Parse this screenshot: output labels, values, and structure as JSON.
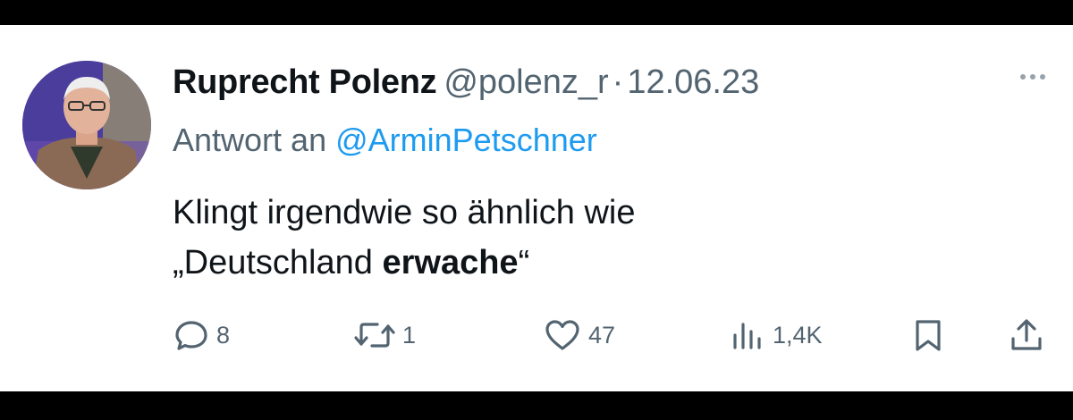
{
  "tweet": {
    "author_name": "Ruprecht Polenz",
    "handle": "@polenz_r",
    "separator": "·",
    "date": "12.06.23",
    "reply_prefix": "Antwort an",
    "reply_mention": "@ArminPetschner",
    "body_line1": "Klingt irgendwie so ähnlich wie",
    "body_line2_open_quote": "„",
    "body_line2_normal": "Deutschland ",
    "body_line2_bold": "erwache",
    "body_line2_close_quote": "“"
  },
  "actions": {
    "replies": {
      "icon": "reply-icon",
      "count": "8"
    },
    "reposts": {
      "icon": "repost-icon",
      "count": "1"
    },
    "likes": {
      "icon": "heart-icon",
      "count": "47"
    },
    "views": {
      "icon": "views-icon",
      "count": "1,4K"
    },
    "bookmark": {
      "icon": "bookmark-icon"
    },
    "share": {
      "icon": "share-icon"
    }
  },
  "colors": {
    "text_primary": "#0f1419",
    "text_secondary": "#536471",
    "mention": "#1d9bf0",
    "frame_background": "#000000",
    "card_background": "#ffffff"
  }
}
